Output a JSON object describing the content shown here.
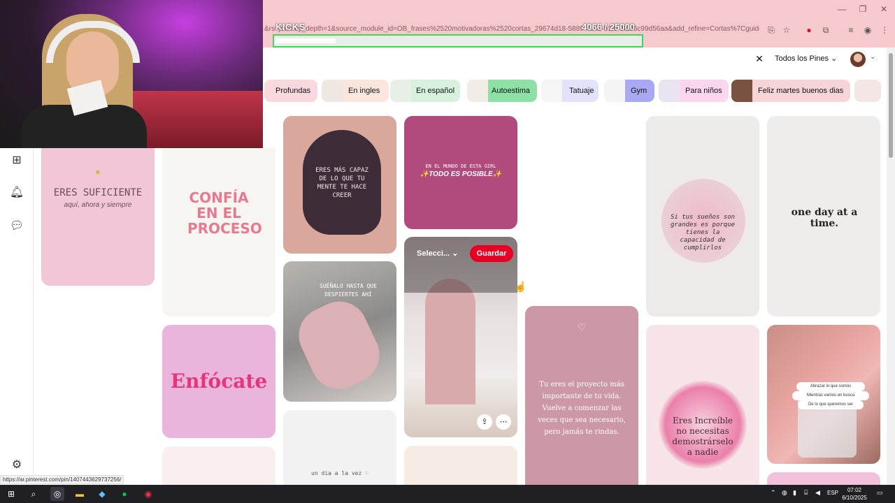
{
  "browser": {
    "url": "&rs=journey_depth=1&source_module_id=OB_frases%2520motivadoras%2520cortas_29674d18-5889-4b4b-b1f0-9fa96c99d56aa&add_refine=Cortas%7Cguide%7C...",
    "status_link": "https://ar.pinterest.com/pin/1407443629737256/",
    "window_controls": [
      "—",
      "❐",
      "✕"
    ]
  },
  "overlay": {
    "kicks_label": "KICKS",
    "kicks_count": "4066 / 25000",
    "kicks_progress": 0.1626
  },
  "search": {
    "filter_label": "Todos los Pines",
    "close_icon": "close-icon"
  },
  "chips": [
    {
      "label": "Profundas",
      "color": "#f9d9dd"
    },
    {
      "label": "En ingles",
      "color": "#fbe6de"
    },
    {
      "label": "En español",
      "color": "#d8f1dd"
    },
    {
      "label": "Autoestima",
      "color": "#8de0a6"
    },
    {
      "label": "Tatuaje",
      "color": "#e2e3fb"
    },
    {
      "label": "Gym",
      "color": "#a9a8f3"
    },
    {
      "label": "Para niños",
      "color": "#fbd6ee"
    },
    {
      "label": "Feliz martes buenos dias",
      "color": "#f6d4d8"
    }
  ],
  "pins": {
    "p1": {
      "text1": "ERES SUFICIENTE",
      "text2": "aquí, ahora y siempre"
    },
    "p2": {
      "text": "CONFÍA EN EL PROCESO"
    },
    "p3": {
      "text": "ERES MÁS CAPAZ DE LO QUE TU MENTE TE HACE CREER"
    },
    "p4": {
      "text1": "EN EL MUNDO DE ESTA GIRL",
      "text2": "✨TODO ES POSIBLE✨"
    },
    "p5": {
      "board_label": "Selecci...",
      "save_label": "Guardar"
    },
    "p6": {
      "text": "SUÉÑALO HASTA QUE DESPIERTES AHÍ"
    },
    "p7": {
      "text": "Enfócate"
    },
    "p8": {
      "text": "un dia a la vez ♡"
    },
    "p9": {
      "text": "Tu eres el proyecto más importante de tu vida. Vuelve a comenzar las veces que sea necesario, pero jamás te rindas."
    },
    "p10": {
      "text": "Si tus sueños son grandes es porque tienes la capacidad de cumplirlos"
    },
    "p11": {
      "text": "one day at a time."
    },
    "p12": {
      "text": "Eres Increíble no necesitas demostrárselo a nadie"
    },
    "p13": {
      "line1": "Abrazar lo que somos",
      "line2": "Mientras vamos en busca",
      "line3": "De lo que queremos ser"
    }
  },
  "taskbar": {
    "language": "ESP",
    "time": "07:02",
    "date": "6/10/2025"
  }
}
